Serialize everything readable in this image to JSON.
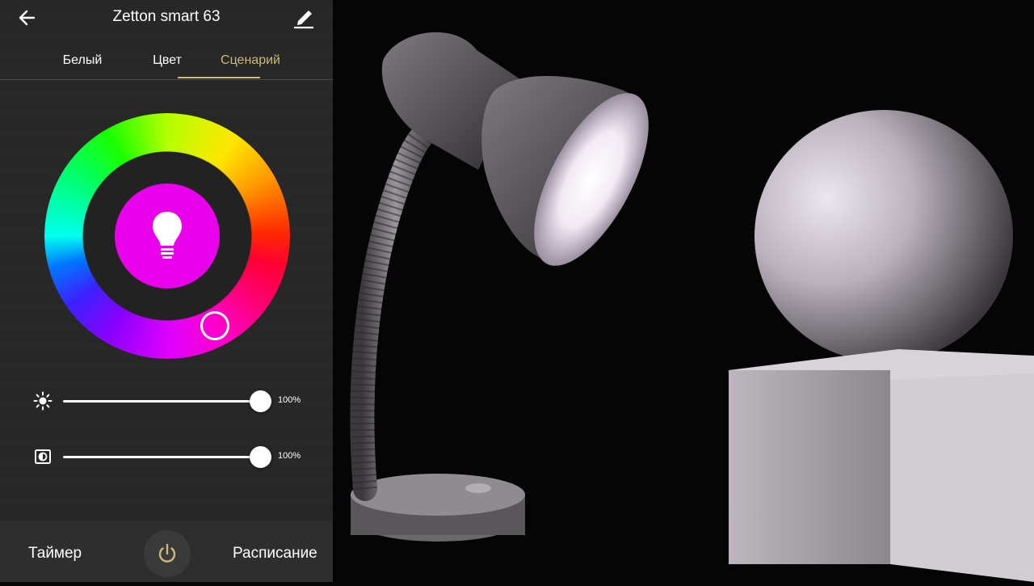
{
  "header": {
    "title": "Zetton smart 63",
    "back_icon": "arrow-left-icon",
    "edit_icon": "pencil-icon"
  },
  "tabs": [
    {
      "label": "Белый",
      "active": false
    },
    {
      "label": "Цвет",
      "active": false
    },
    {
      "label": "Сценарий",
      "active": true
    }
  ],
  "color_wheel": {
    "selected_color": "#e800ea",
    "center_icon": "light-bulb-icon"
  },
  "sliders": [
    {
      "icon": "brightness-sun-icon",
      "value": 100,
      "value_label": "100%"
    },
    {
      "icon": "contrast-icon",
      "value": 100,
      "value_label": "100%"
    }
  ],
  "footer": {
    "timer_label": "Таймер",
    "schedule_label": "Расписание",
    "power_icon": "power-icon"
  },
  "colors": {
    "accent": "#cdb978",
    "panel_bg": "#262626",
    "footer_bg": "#2e2e2e",
    "selected_color": "#e800ea"
  },
  "scene": {
    "description_icons": [
      "desk-lamp-illustration",
      "sphere-on-cube-illustration"
    ]
  }
}
